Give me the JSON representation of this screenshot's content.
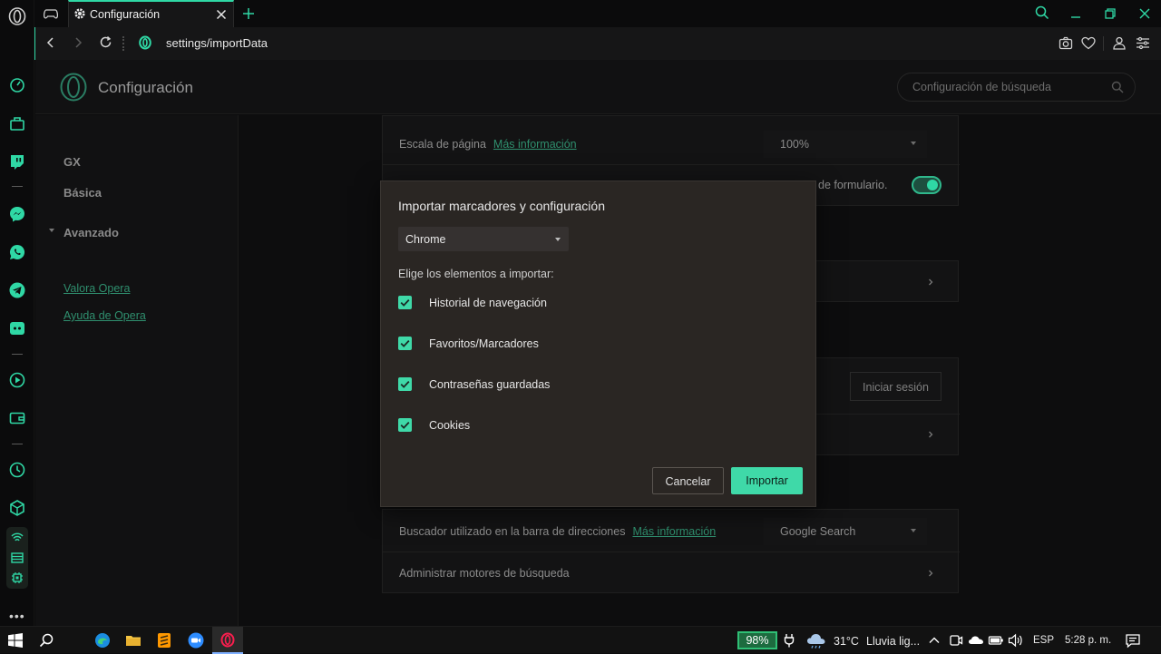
{
  "browser": {
    "tab_title": "Configuración",
    "url": "settings/importData"
  },
  "settings": {
    "title": "Configuración",
    "search_placeholder": "Configuración de búsqueda",
    "nav": {
      "items": [
        "GX",
        "Básica",
        "Avanzado"
      ],
      "links": [
        "Valora Opera",
        "Ayuda de Opera"
      ]
    },
    "content": {
      "page_zoom_label": "Escala de página",
      "more_info": "Más información",
      "page_zoom_value": "100%",
      "autofill_partial": "de formulario.",
      "sign_in_button": "Iniciar sesión",
      "search_engine_label": "Buscador utilizado en la barra de direcciones",
      "search_engine_value": "Google Search",
      "manage_engines_label": "Administrar motores de búsqueda"
    }
  },
  "dialog": {
    "title": "Importar marcadores y configuración",
    "browser_select": "Chrome",
    "subtitle": "Elige los elementos a importar:",
    "items": [
      {
        "label": "Historial de navegación",
        "checked": true
      },
      {
        "label": "Favoritos/Marcadores",
        "checked": true
      },
      {
        "label": "Contraseñas guardadas",
        "checked": true
      },
      {
        "label": "Cookies",
        "checked": true
      }
    ],
    "cancel_label": "Cancelar",
    "import_label": "Importar"
  },
  "taskbar": {
    "battery": "98%",
    "temperature": "31°C",
    "weather": "Lluvia lig...",
    "language": "ESP",
    "time": "5:28 p. m."
  },
  "colors": {
    "accent": "#3fd9a8",
    "dialog_bg": "#2a2623"
  }
}
